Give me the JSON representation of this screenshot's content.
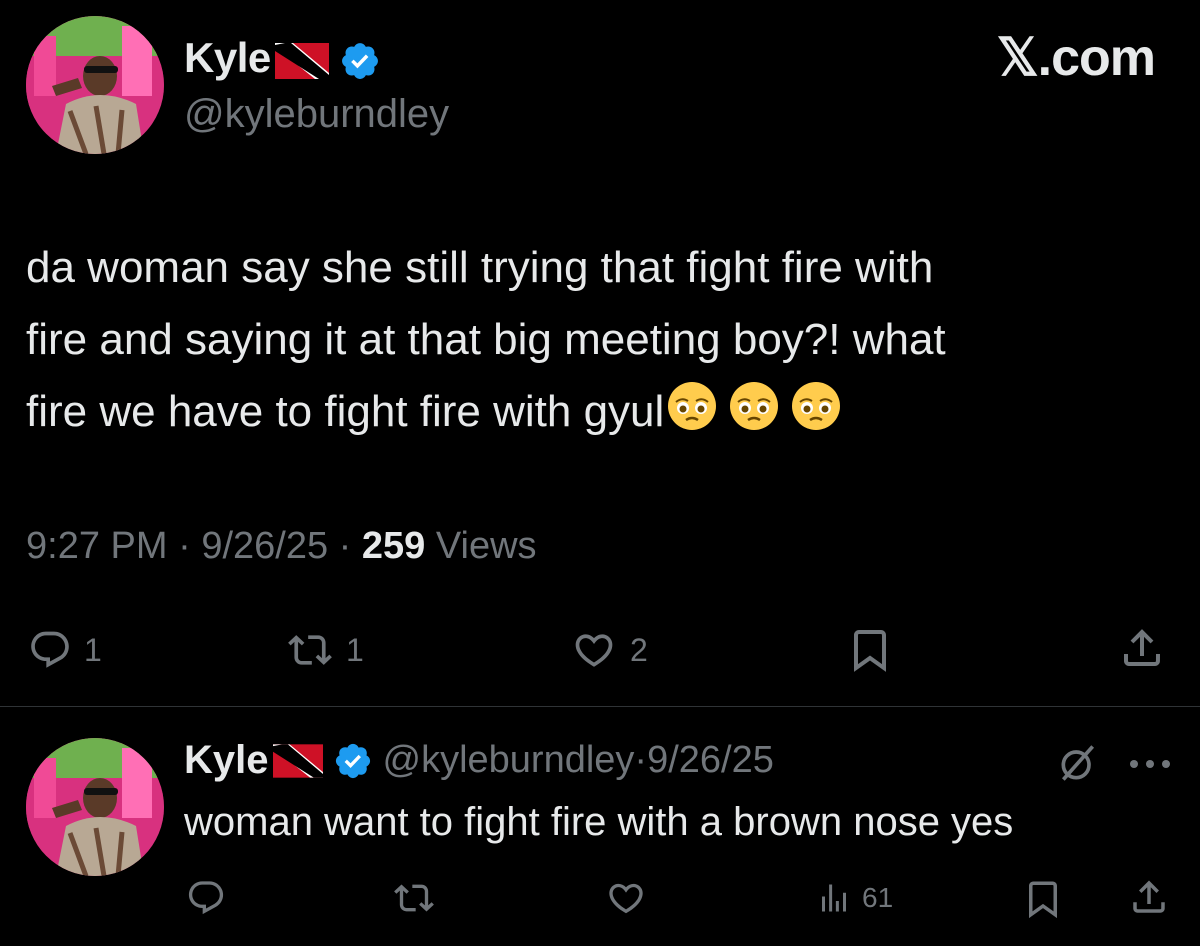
{
  "tweet": {
    "author_name": "Kyle",
    "handle": "@kyleburndley",
    "brand": "X.com",
    "text_line1": "da woman say she still trying that fight fire with",
    "text_line2": "fire and saying it at that big meeting boy?! what",
    "text_line3": "fire we have to fight fire with gyul",
    "emoji": "pleading-face",
    "time": "9:27 PM",
    "date": "9/26/25",
    "views_count": "259",
    "views_label": "Views",
    "separator": "·",
    "actions": {
      "reply_count": "1",
      "repost_count": "1",
      "like_count": "2"
    }
  },
  "reply": {
    "author_name": "Kyle",
    "handle": "@kyleburndley",
    "date": "9/26/25",
    "separator": "·",
    "text": "woman want to fight fire with a brown nose yes",
    "views_count": "61"
  },
  "colors": {
    "background": "#000000",
    "primary_text": "#e7e9ea",
    "secondary_text": "#71767b",
    "verified_blue": "#1d9bf0",
    "divider": "#2f3336"
  },
  "icons": [
    "verified-badge-icon",
    "trinidad-flag-icon",
    "reply-icon",
    "repost-icon",
    "like-icon",
    "bookmark-icon",
    "share-icon",
    "views-icon",
    "grok-icon",
    "more-icon"
  ]
}
